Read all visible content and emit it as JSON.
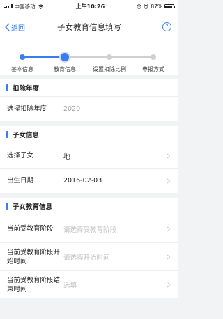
{
  "status_bar": {
    "carrier": "中国移动",
    "time": "上午10:26",
    "battery": "87%"
  },
  "nav": {
    "back_label": "返回",
    "title": "子女教育信息填写",
    "help_label": "?"
  },
  "steps": [
    {
      "label": "基本信息",
      "state": "done"
    },
    {
      "label": "教育信息",
      "state": "current"
    },
    {
      "label": "设置扣除比例",
      "state": "todo"
    },
    {
      "label": "申报方式",
      "state": "todo"
    }
  ],
  "sections": {
    "deduction_year": {
      "title": "扣除年度",
      "rows": [
        {
          "label": "选择扣除年度",
          "value": "2020"
        }
      ]
    },
    "child_info": {
      "title": "子女信息",
      "rows": [
        {
          "label": "选择子女",
          "value": "地"
        },
        {
          "label": "出生日期",
          "value": "2016-02-03"
        }
      ]
    },
    "child_education": {
      "title": "子女教育信息",
      "rows": [
        {
          "label": "当前受教育阶段",
          "placeholder": "请选择受教育阶段"
        },
        {
          "label": "当前受教育阶段开始时间",
          "placeholder": "请选择开始时间"
        },
        {
          "label": "当前受教育阶段结束时间",
          "placeholder": "选填"
        }
      ]
    }
  },
  "colors": {
    "accent": "#3a7cf1",
    "inactive_step": "#d0d0d0",
    "background": "#f2f3f5"
  }
}
